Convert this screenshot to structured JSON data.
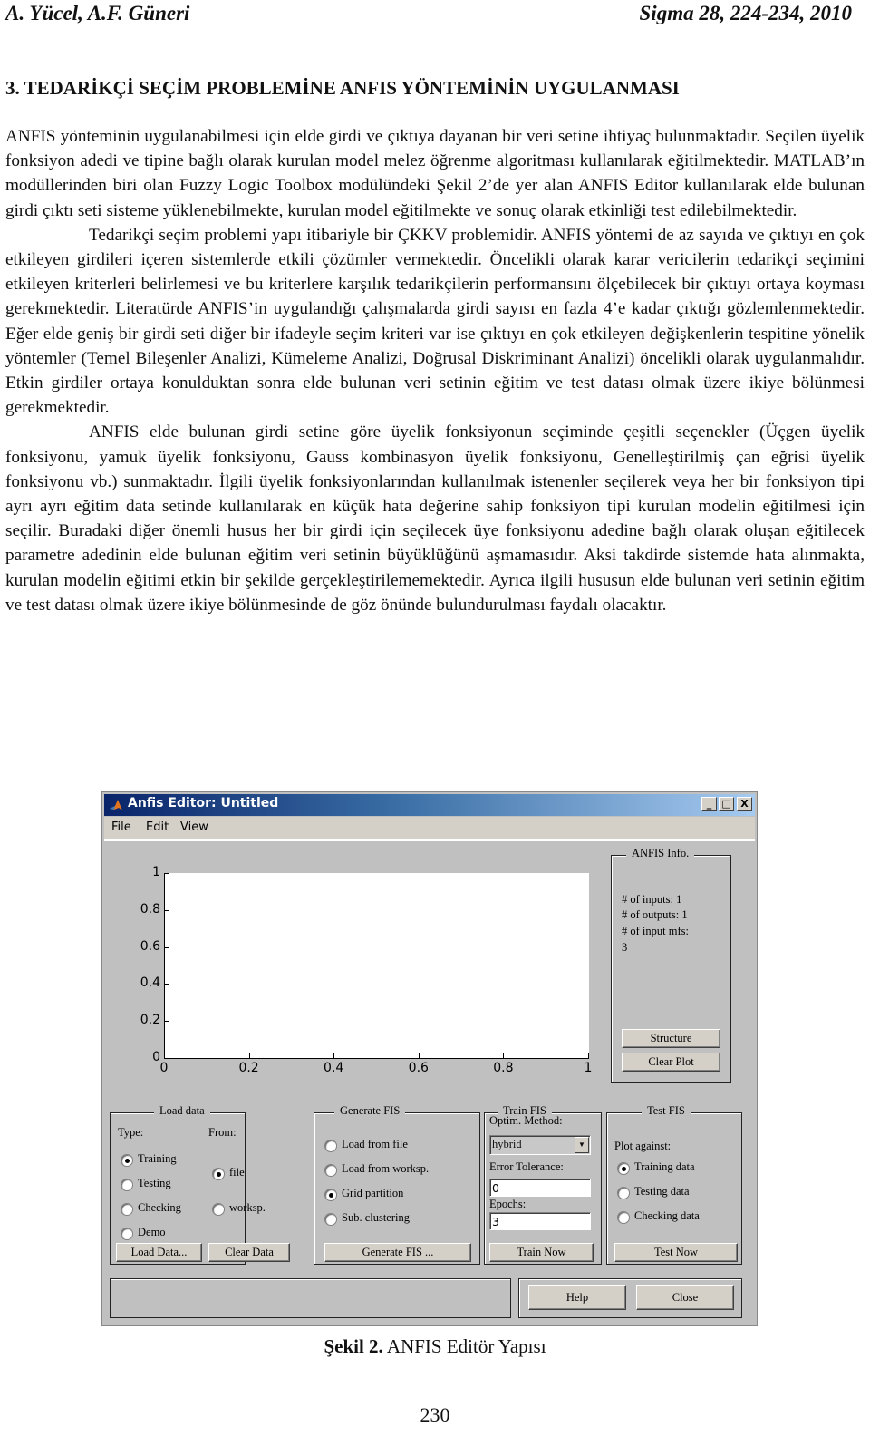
{
  "header": {
    "authors": "A. Yücel, A.F. Güneri",
    "journal": "Sigma 28, 224-234, 2010"
  },
  "section_title": "3. TEDARİKÇİ SEÇİM PROBLEMİNE ANFIS YÖNTEMİNİN UYGULANMASI",
  "paragraphs": [
    "ANFIS yönteminin uygulanabilmesi için elde girdi ve çıktıya dayanan bir veri setine ihtiyaç bulunmaktadır. Seçilen üyelik fonksiyon adedi ve tipine bağlı olarak kurulan model melez öğrenme algoritması kullanılarak eğitilmektedir. MATLAB’ın modüllerinden biri olan Fuzzy Logic Toolbox modülündeki Şekil 2’de yer alan ANFIS Editor kullanılarak elde bulunan girdi çıktı seti sisteme yüklenebilmekte, kurulan model eğitilmekte ve sonuç olarak etkinliği test edilebilmektedir.",
    "Tedarikçi seçim problemi yapı itibariyle bir ÇKKV problemidir. ANFIS yöntemi de az sayıda ve çıktıyı en çok etkileyen girdileri içeren sistemlerde etkili çözümler vermektedir. Öncelikli olarak karar vericilerin  tedarikçi seçimini etkileyen kriterleri belirlemesi ve bu kriterlere karşılık tedarikçilerin performansını ölçebilecek bir çıktıyı ortaya koyması gerekmektedir. Literatürde ANFIS’in uygulandığı çalışmalarda girdi sayısı en fazla 4’e kadar çıktığı gözlemlenmektedir. Eğer elde geniş bir girdi seti diğer bir ifadeyle seçim kriteri var ise çıktıyı en çok etkileyen değişkenlerin tespitine yönelik yöntemler (Temel Bileşenler Analizi, Kümeleme Analizi, Doğrusal Diskriminant Analizi) öncelikli olarak uygulanmalıdır. Etkin girdiler ortaya konulduktan sonra elde bulunan veri setinin eğitim ve test datası olmak üzere ikiye bölünmesi gerekmektedir.",
    "ANFIS elde bulunan girdi setine göre üyelik fonksiyonun seçiminde çeşitli seçenekler (Üçgen üyelik fonksiyonu, yamuk üyelik fonksiyonu, Gauss kombinasyon üyelik fonksiyonu, Genelleştirilmiş çan eğrisi üyelik fonksiyonu vb.) sunmaktadır. İlgili üyelik fonksiyonlarından kullanılmak istenenler seçilerek veya her bir fonksiyon tipi ayrı ayrı eğitim data setinde kullanılarak en küçük hata değerine sahip fonksiyon tipi kurulan modelin eğitilmesi için seçilir. Buradaki diğer önemli husus her bir girdi için seçilecek üye fonksiyonu adedine bağlı olarak oluşan eğitilecek parametre adedinin elde bulunan eğitim veri setinin büyüklüğünü aşmamasıdır. Aksi takdirde sistemde hata alınmakta, kurulan modelin eğitimi etkin bir şekilde gerçekleştirilememektedir. Ayrıca ilgili hususun elde bulunan veri setinin eğitim ve test datası olmak üzere ikiye bölünmesinde de göz önünde bulundurulması faydalı olacaktır."
  ],
  "figure": {
    "window_title": "Anfis Editor: Untitled",
    "title_buttons": {
      "minimize": "_",
      "maximize": "□",
      "close": "X"
    },
    "menu": [
      "File",
      "Edit",
      "View"
    ],
    "plot": {
      "y_ticks": [
        "1",
        "0.8",
        "0.6",
        "0.4",
        "0.2",
        "0"
      ],
      "x_ticks": [
        "0",
        "0.2",
        "0.4",
        "0.6",
        "0.8",
        "1"
      ]
    },
    "anfis_info": {
      "label": "ANFIS Info.",
      "lines": [
        "# of inputs: 1",
        "# of outputs: 1",
        "# of input mfs:",
        "3"
      ],
      "structure_button": "Structure",
      "clear_plot_button": "Clear Plot"
    },
    "load_data": {
      "label": "Load data",
      "type_label": "Type:",
      "from_label": "From:",
      "types": [
        {
          "label": "Training",
          "selected": true
        },
        {
          "label": "Testing",
          "selected": false
        },
        {
          "label": "Checking",
          "selected": false
        },
        {
          "label": "Demo",
          "selected": false
        }
      ],
      "sources": [
        {
          "label": "file",
          "selected": true
        },
        {
          "label": "worksp.",
          "selected": false
        }
      ],
      "load_button": "Load Data...",
      "clear_button": "Clear Data"
    },
    "generate_fis": {
      "label": "Generate FIS",
      "options": [
        {
          "label": "Load from file",
          "selected": false
        },
        {
          "label": "Load from worksp.",
          "selected": false
        },
        {
          "label": "Grid partition",
          "selected": true
        },
        {
          "label": "Sub. clustering",
          "selected": false
        }
      ],
      "button": "Generate FIS ..."
    },
    "train_fis": {
      "label": "Train FIS",
      "method_label": "Optim. Method:",
      "method_value": "hybrid",
      "error_label": "Error Tolerance:",
      "error_value": "0",
      "epochs_label": "Epochs:",
      "epochs_value": "3",
      "button": "Train Now"
    },
    "test_fis": {
      "label": "Test FIS",
      "plot_against_label": "Plot against:",
      "options": [
        {
          "label": "Training data",
          "selected": true
        },
        {
          "label": "Testing data",
          "selected": false
        },
        {
          "label": "Checking data",
          "selected": false
        }
      ],
      "button": "Test Now"
    },
    "help_button": "Help",
    "close_button": "Close",
    "caption_bold": "Şekil 2.",
    "caption_text": " ANFIS Editör Yapısı"
  },
  "page_number": "230"
}
